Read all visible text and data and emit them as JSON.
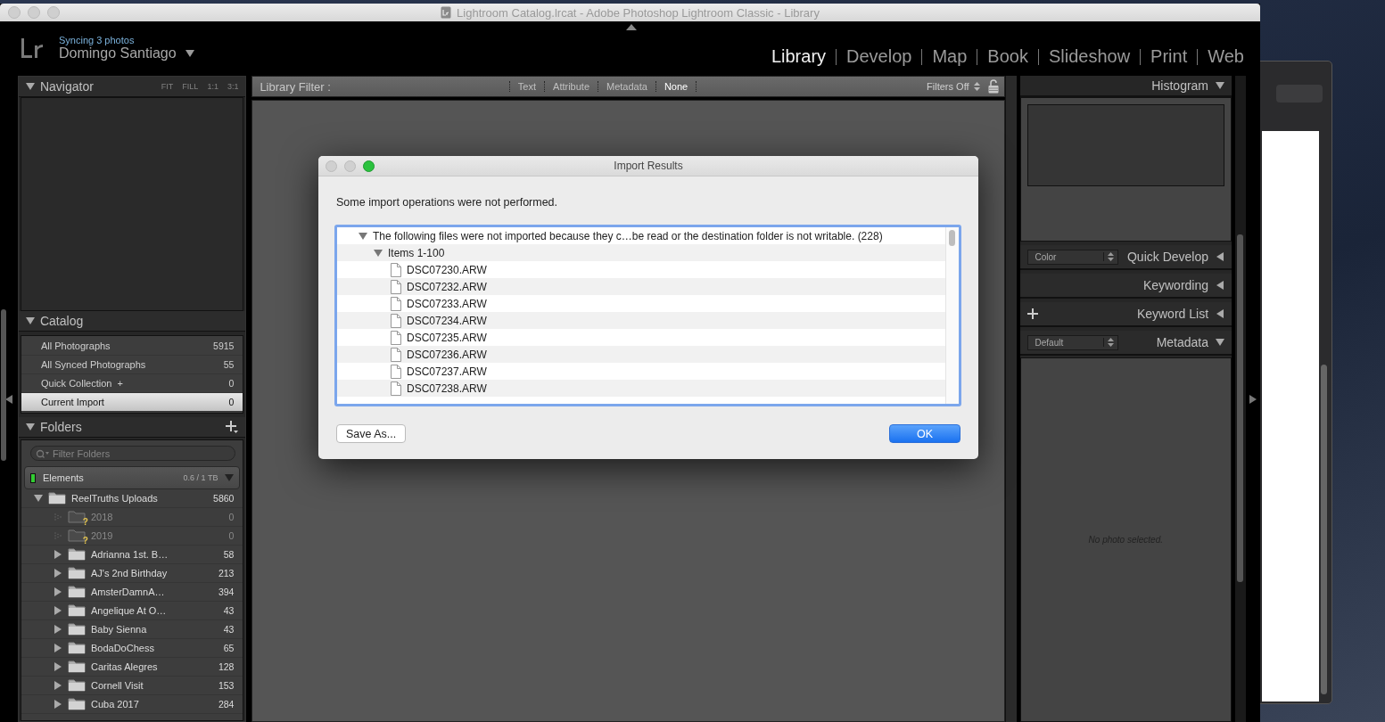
{
  "window": {
    "title": "Lightroom Catalog.lrcat - Adobe Photoshop Lightroom Classic - Library"
  },
  "identity": {
    "sync_status": "Syncing 3 photos",
    "name": "Domingo Santiago"
  },
  "modules": [
    {
      "label": "Library",
      "selected": true
    },
    {
      "label": "Develop",
      "selected": false
    },
    {
      "label": "Map",
      "selected": false
    },
    {
      "label": "Book",
      "selected": false
    },
    {
      "label": "Slideshow",
      "selected": false
    },
    {
      "label": "Print",
      "selected": false
    },
    {
      "label": "Web",
      "selected": false
    }
  ],
  "navigator": {
    "title": "Navigator",
    "zoom_options": [
      "FIT",
      "FILL",
      "1:1",
      "3:1"
    ]
  },
  "catalog": {
    "title": "Catalog",
    "items": [
      {
        "label": "All Photographs",
        "count": "5915",
        "selected": false
      },
      {
        "label": "All Synced Photographs",
        "count": "55",
        "selected": false
      },
      {
        "label": "Quick Collection",
        "suffix": "+",
        "count": "0",
        "selected": false
      },
      {
        "label": "Current Import",
        "count": "0",
        "selected": true
      }
    ]
  },
  "folders": {
    "title": "Folders",
    "filter_placeholder": "Filter Folders",
    "volume": {
      "name": "Elements",
      "usage": "0.6 / 1 TB"
    },
    "tree": [
      {
        "name": "ReelTruths Uploads",
        "count": "5860",
        "kind": "folder",
        "expanded": true,
        "children": [
          {
            "name": "2018",
            "count": "0",
            "kind": "missing",
            "badge": "?",
            "expanded": false
          },
          {
            "name": "2019",
            "count": "0",
            "kind": "missing",
            "badge": "?",
            "expanded": false
          },
          {
            "name": "Adrianna 1st. B…",
            "count": "58",
            "kind": "folder",
            "expanded": false
          },
          {
            "name": "AJ's 2nd Birthday",
            "count": "213",
            "kind": "folder",
            "expanded": false
          },
          {
            "name": "AmsterDamnA…",
            "count": "394",
            "kind": "folder",
            "expanded": false
          },
          {
            "name": "Angelique At O…",
            "count": "43",
            "kind": "folder",
            "expanded": false
          },
          {
            "name": "Baby Sienna",
            "count": "43",
            "kind": "folder",
            "expanded": false
          },
          {
            "name": "BodaDoChess",
            "count": "65",
            "kind": "folder",
            "expanded": false
          },
          {
            "name": "Caritas Alegres",
            "count": "128",
            "kind": "folder",
            "expanded": false
          },
          {
            "name": "Cornell Visit",
            "count": "153",
            "kind": "folder",
            "expanded": false
          },
          {
            "name": "Cuba 2017",
            "count": "284",
            "kind": "folder",
            "expanded": false
          }
        ]
      }
    ]
  },
  "library_filter": {
    "label": "Library Filter :",
    "options": [
      {
        "label": "Text",
        "selected": false
      },
      {
        "label": "Attribute",
        "selected": false
      },
      {
        "label": "Metadata",
        "selected": false
      },
      {
        "label": "None",
        "selected": true
      }
    ],
    "preset": "Filters Off"
  },
  "histogram": {
    "title": "Histogram"
  },
  "right_sections": [
    {
      "title": "Quick Develop",
      "kind": "popup",
      "control": "Color",
      "expanded": false
    },
    {
      "title": "Keywording",
      "kind": "plain",
      "expanded": false
    },
    {
      "title": "Keyword List",
      "kind": "add",
      "expanded": false
    },
    {
      "title": "Metadata",
      "kind": "popup",
      "control": "Default",
      "expanded": true
    }
  ],
  "metadata_message": "No photo selected.",
  "dialog": {
    "title": "Import Results",
    "message": "Some import operations were not performed.",
    "tree": [
      {
        "label": "The following files were not imported because they c…be read or the destination folder is not writable. (228)",
        "expanded": true,
        "children": [
          {
            "label": "Items 1-100",
            "expanded": true,
            "children": [
              {
                "label": "DSC07230.ARW"
              },
              {
                "label": "DSC07232.ARW"
              },
              {
                "label": "DSC07233.ARW"
              },
              {
                "label": "DSC07234.ARW"
              },
              {
                "label": "DSC07235.ARW"
              },
              {
                "label": "DSC07236.ARW"
              },
              {
                "label": "DSC07237.ARW"
              },
              {
                "label": "DSC07238.ARW"
              }
            ]
          }
        ]
      }
    ],
    "buttons": [
      {
        "label": "Save As...",
        "default": false
      },
      {
        "label": "OK",
        "default": true
      }
    ]
  }
}
